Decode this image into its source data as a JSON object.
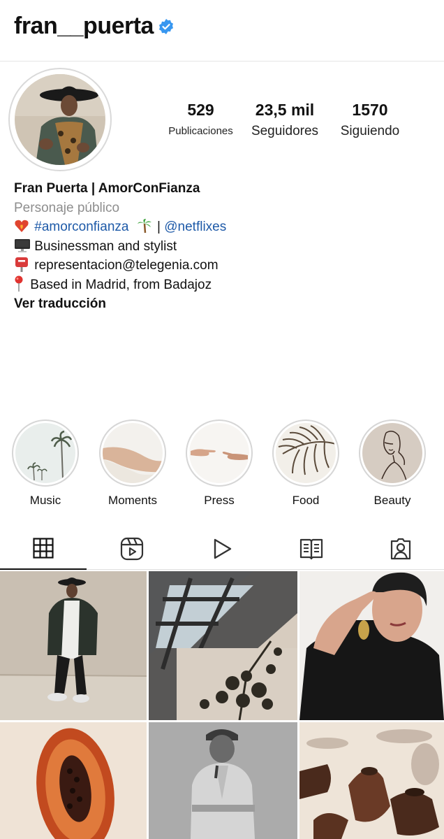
{
  "header": {
    "username": "fran__puerta",
    "verified_icon": "verified-badge-icon",
    "verified_color": "#3897f0"
  },
  "stats": {
    "posts_count": "529",
    "posts_label": "Publicaciones",
    "followers_count": "23,5 mil",
    "followers_label": "Seguidores",
    "following_count": "1570",
    "following_label": "Siguiendo"
  },
  "bio": {
    "name": "Fran Puerta | AmorConFianza",
    "category": "Personaje público",
    "line1_hashtag": "#amorconfianza",
    "line1_separator": "|",
    "line1_mention": "@netflixes",
    "line2": "Businessman and stylist",
    "line3": "representacion@telegenia.com",
    "line4": "Based in Madrid, from Badajoz",
    "translate_label": "Ver traducción",
    "link_color": "#1e5aa8"
  },
  "highlights": [
    {
      "label": "Music",
      "icon": "palm-trees-thumbnail"
    },
    {
      "label": "Moments",
      "icon": "beach-thumbnail"
    },
    {
      "label": "Press",
      "icon": "hands-thumbnail"
    },
    {
      "label": "Food",
      "icon": "palm-leaf-thumbnail"
    },
    {
      "label": "Beauty",
      "icon": "face-line-art-thumbnail"
    }
  ],
  "tabs": [
    {
      "icon": "grid-icon",
      "active": true
    },
    {
      "icon": "reels-icon",
      "active": false
    },
    {
      "icon": "video-play-icon",
      "active": false
    },
    {
      "icon": "guides-icon",
      "active": false
    },
    {
      "icon": "tagged-icon",
      "active": false
    }
  ]
}
